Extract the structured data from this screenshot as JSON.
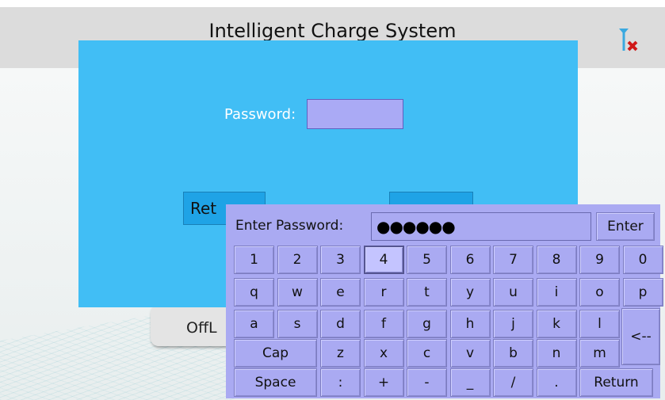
{
  "app": {
    "title": "Intelligent Charge System"
  },
  "status": {
    "signal_icon": "antenna-disconnected-icon"
  },
  "background_button": {
    "label": "OffL"
  },
  "login": {
    "password_label": "Password:",
    "password_value": "",
    "return_label": "Ret",
    "login_label": ""
  },
  "keyboard": {
    "prompt": "Enter Password:",
    "masked_value": "●●●●●●",
    "enter_label": "Enter",
    "pressed_key": "4",
    "rows": [
      [
        "1",
        "2",
        "3",
        "4",
        "5",
        "6",
        "7",
        "8",
        "9",
        "0"
      ],
      [
        "q",
        "w",
        "e",
        "r",
        "t",
        "y",
        "u",
        "i",
        "o",
        "p"
      ],
      [
        "a",
        "s",
        "d",
        "f",
        "g",
        "h",
        "j",
        "k",
        "l"
      ],
      [
        "Cap",
        "z",
        "x",
        "c",
        "v",
        "b",
        "n",
        "m"
      ],
      [
        "Space",
        ":",
        "+",
        "-",
        "_",
        "/",
        ".",
        "Return"
      ]
    ],
    "backspace_label": "<--"
  },
  "colors": {
    "title_bar": "#dcdcdc",
    "panel": "#41bef5",
    "keyboard": "#aaaaf2",
    "button": "#1fa3e6",
    "error_mark": "#d01818"
  }
}
